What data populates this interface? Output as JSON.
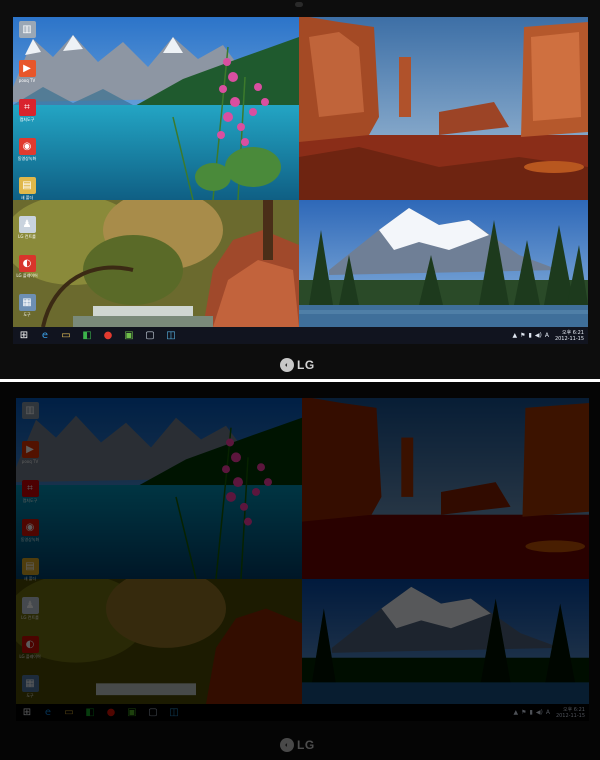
{
  "brand": {
    "logo_text": "LG"
  },
  "desktop_icons": [
    {
      "name": "recycle-bin",
      "label": "",
      "color": "#9aa7b5",
      "glyph": "▥"
    },
    {
      "name": "pooq-tv",
      "label": "pooq TV",
      "color": "#e8562a",
      "glyph": "▶"
    },
    {
      "name": "capture-app",
      "label": "캡처도구",
      "color": "#d9232d",
      "glyph": "⌗"
    },
    {
      "name": "recording-app",
      "label": "동영상녹화",
      "color": "#e03a2f",
      "glyph": "◉"
    },
    {
      "name": "folder",
      "label": "새 폴더",
      "color": "#e0b84a",
      "glyph": "▤"
    },
    {
      "name": "user-app",
      "label": "LG 컨트롤",
      "color": "#c9d3de",
      "glyph": "♟"
    },
    {
      "name": "media-app",
      "label": "LG 플레이어",
      "color": "#d8342b",
      "glyph": "◐"
    },
    {
      "name": "tool-app",
      "label": "도구",
      "color": "#6d8fb3",
      "glyph": "▦"
    }
  ],
  "taskbar": {
    "buttons": [
      {
        "name": "start-button",
        "glyph": "⊞",
        "color": "#ffffff"
      },
      {
        "name": "ie-button",
        "glyph": "e",
        "color": "#3aa0e8"
      },
      {
        "name": "explorer-button",
        "glyph": "▭",
        "color": "#e8c25a"
      },
      {
        "name": "store-button",
        "glyph": "◧",
        "color": "#3cb44b"
      },
      {
        "name": "media-button",
        "glyph": "●",
        "color": "#e33a2f"
      },
      {
        "name": "photo-button",
        "glyph": "▣",
        "color": "#6fbf4a"
      },
      {
        "name": "window-button",
        "glyph": "▢",
        "color": "#c9d3de"
      },
      {
        "name": "remote-button",
        "glyph": "◫",
        "color": "#5ab8e8"
      }
    ],
    "tray_icons": [
      "▲",
      "⚑",
      "▮",
      "◀)",
      "A"
    ],
    "clock": {
      "time": "오후 6:21",
      "date": "2012-11-15"
    }
  }
}
